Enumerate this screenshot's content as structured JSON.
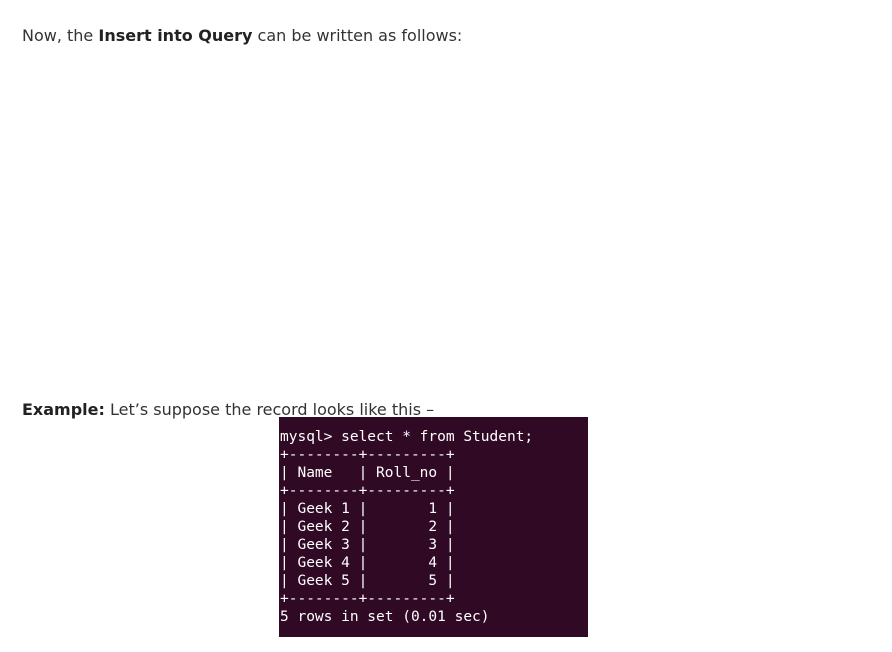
{
  "intro": {
    "prefix": "Now, the ",
    "bold": "Insert into Query",
    "suffix": " can be written as follows:"
  },
  "example": {
    "bold": "Example:",
    "text": " Let’s suppose the record looks like this –"
  },
  "terminal": {
    "background": "#300a24",
    "text_color": "#ffffff",
    "lines": [
      "mysql> select * from Student;",
      "+--------+---------+",
      "| Name   | Roll_no |",
      "+--------+---------+",
      "| Geek 1 |       1 |",
      "| Geek 2 |       2 |",
      "| Geek 3 |       3 |",
      "| Geek 4 |       4 |",
      "| Geek 5 |       5 |",
      "+--------+---------+",
      "5 rows in set (0.01 sec)"
    ]
  }
}
